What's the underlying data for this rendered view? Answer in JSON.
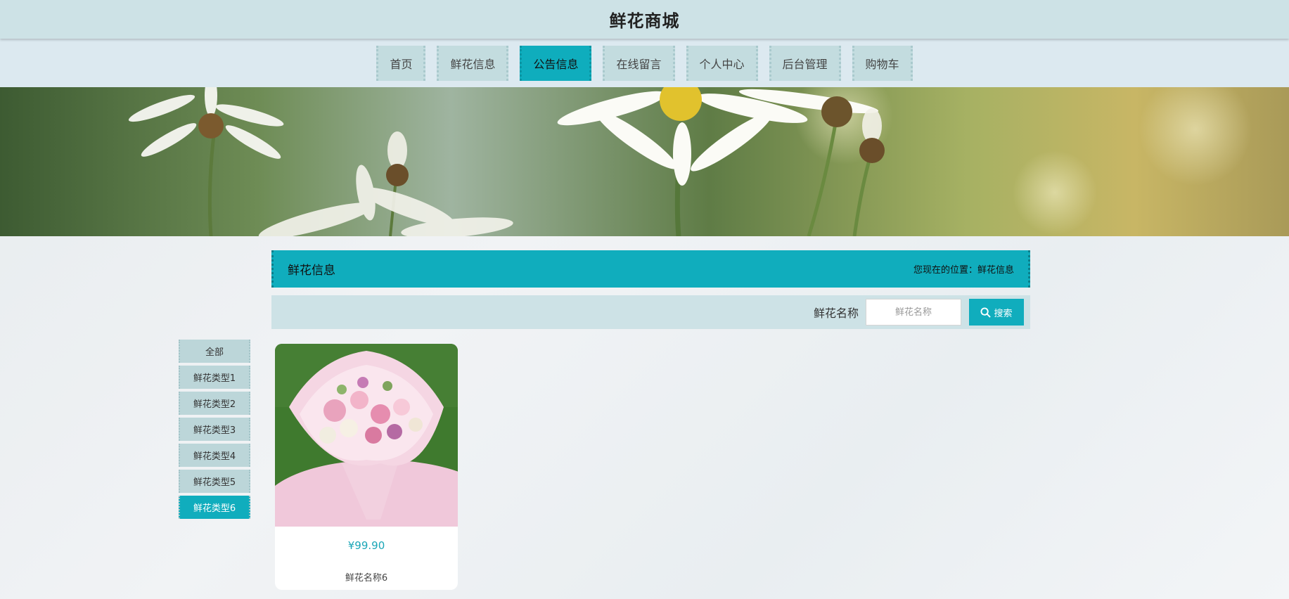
{
  "header": {
    "title": "鲜花商城"
  },
  "nav": {
    "items": [
      {
        "label": "首页"
      },
      {
        "label": "鲜花信息"
      },
      {
        "label": "公告信息"
      },
      {
        "label": "在线留言"
      },
      {
        "label": "个人中心"
      },
      {
        "label": "后台管理"
      },
      {
        "label": "购物车"
      }
    ],
    "active": "公告信息"
  },
  "section": {
    "title": "鲜花信息",
    "breadcrumb": "您现在的位置：鲜花信息"
  },
  "search": {
    "label": "鲜花名称",
    "placeholder": "鲜花名称",
    "value": "",
    "button": "搜索"
  },
  "categories": {
    "items": [
      {
        "label": "全部"
      },
      {
        "label": "鲜花类型1"
      },
      {
        "label": "鲜花类型2"
      },
      {
        "label": "鲜花类型3"
      },
      {
        "label": "鲜花类型4"
      },
      {
        "label": "鲜花类型5"
      },
      {
        "label": "鲜花类型6"
      }
    ],
    "active": "鲜花类型6"
  },
  "products": [
    {
      "price": "¥99.90",
      "name": "鲜花名称6"
    }
  ],
  "colors": {
    "accent": "#10adbd",
    "header_bg": "#cde2e6",
    "nav_bg": "#dce9f0"
  }
}
